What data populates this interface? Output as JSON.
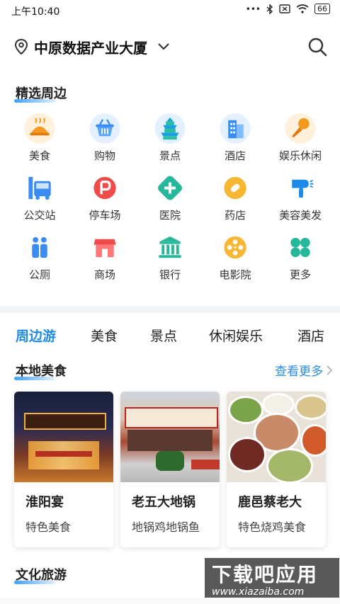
{
  "status_bar": {
    "time": "上午10:40",
    "battery": "66"
  },
  "location": {
    "name": "中原数据产业大厦"
  },
  "nearby": {
    "title": "精选周边",
    "items": [
      {
        "label": "美食",
        "icon": "food-icon"
      },
      {
        "label": "购物",
        "icon": "shopping-basket-icon"
      },
      {
        "label": "景点",
        "icon": "temple-icon"
      },
      {
        "label": "酒店",
        "icon": "hotel-building-icon"
      },
      {
        "label": "娱乐休闲",
        "icon": "microphone-icon"
      },
      {
        "label": "公交站",
        "icon": "bus-icon"
      },
      {
        "label": "停车场",
        "icon": "parking-icon"
      },
      {
        "label": "医院",
        "icon": "hospital-cross-icon"
      },
      {
        "label": "药店",
        "icon": "pill-icon"
      },
      {
        "label": "美容美发",
        "icon": "hair-dryer-icon"
      },
      {
        "label": "公厕",
        "icon": "restroom-icon"
      },
      {
        "label": "商场",
        "icon": "mall-icon"
      },
      {
        "label": "银行",
        "icon": "bank-icon"
      },
      {
        "label": "电影院",
        "icon": "film-reel-icon"
      },
      {
        "label": "更多",
        "icon": "more-grid-icon"
      }
    ]
  },
  "tabs": [
    {
      "label": "周边游",
      "active": true
    },
    {
      "label": "美食",
      "active": false
    },
    {
      "label": "景点",
      "active": false
    },
    {
      "label": "休闲娱乐",
      "active": false
    },
    {
      "label": "酒店",
      "active": false
    }
  ],
  "local_food": {
    "title": "本地美食",
    "more_label": "查看更多",
    "cards": [
      {
        "name": "淮阳宴",
        "desc": "特色美食"
      },
      {
        "name": "老五大地锅",
        "desc": "地锅鸡地锅鱼"
      },
      {
        "name": "鹿邑蔡老大",
        "desc": "特色烧鸡美食"
      }
    ]
  },
  "culture_travel": {
    "title": "文化旅游"
  },
  "watermark": {
    "line1": "下载吧应用",
    "line2": "www.xiazaiba.com"
  },
  "colors": {
    "accent": "#1e8ae8"
  }
}
